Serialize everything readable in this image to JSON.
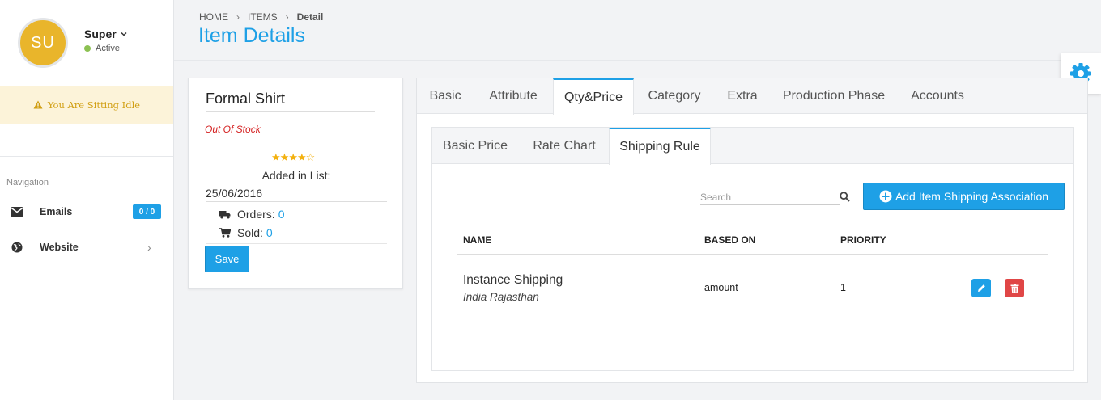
{
  "sidebar": {
    "avatar_initials": "SU",
    "user_name": "Super",
    "user_status": "Active",
    "idle_message": "You Are Sitting Idle",
    "nav_heading": "Navigation",
    "items": [
      {
        "label": "Emails",
        "icon": "envelope-icon",
        "badge": "0 / 0"
      },
      {
        "label": "Website",
        "icon": "globe-icon"
      }
    ]
  },
  "header": {
    "breadcrumbs": [
      "HOME",
      "ITEMS",
      "Detail"
    ],
    "title": "Item Details"
  },
  "item_card": {
    "name": "Formal Shirt",
    "stock_status": "Out Of Stock",
    "rating": 4,
    "rating_max": 5,
    "added_label": "Added in List:",
    "added_date": "25/06/2016",
    "orders_label": "Orders:",
    "orders_value": "0",
    "sold_label": "Sold:",
    "sold_value": "0",
    "save_label": "Save"
  },
  "main_tabs": [
    {
      "label": "Basic",
      "active": false
    },
    {
      "label": "Attribute",
      "active": false
    },
    {
      "label": "Qty&Price",
      "active": true
    },
    {
      "label": "Category",
      "active": false
    },
    {
      "label": "Extra",
      "active": false
    },
    {
      "label": "Production Phase",
      "active": false
    },
    {
      "label": "Accounts",
      "active": false
    }
  ],
  "sub_tabs": [
    {
      "label": "Basic Price",
      "active": false
    },
    {
      "label": "Rate Chart",
      "active": false
    },
    {
      "label": "Shipping Rule",
      "active": true
    }
  ],
  "shipping": {
    "search_placeholder": "Search",
    "add_button_label": "Add Item Shipping Association",
    "columns": [
      "NAME",
      "BASED ON",
      "PRIORITY"
    ],
    "rows": [
      {
        "name": "Instance Shipping",
        "location": "India Rajasthan",
        "based_on": "amount",
        "priority": "1"
      }
    ]
  },
  "colors": {
    "accent": "#1ea0e6",
    "danger": "#e04646",
    "avatar": "#e9b52b",
    "idle_bg": "#fcf3d9",
    "idle_text": "#d19f13",
    "stock_red": "#d42020",
    "star": "#f3b10f",
    "status_dot": "#8cc152"
  }
}
